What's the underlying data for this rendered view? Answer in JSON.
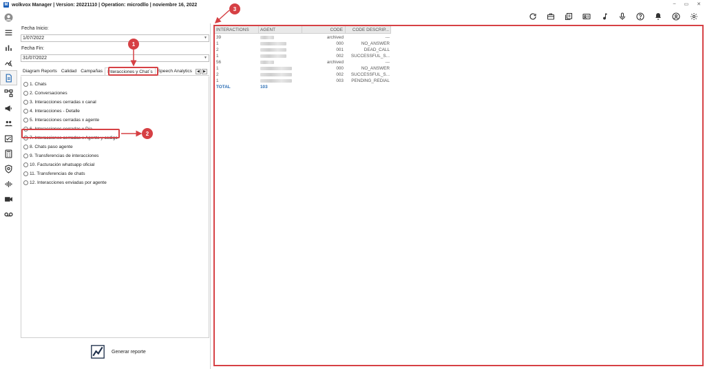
{
  "window": {
    "title": "wolkvox Manager  | Version: 20221110 |  Operation: microdllo | noviembre 16, 2022",
    "logo_letter": "M",
    "controls": [
      "–",
      "▭",
      "✕"
    ]
  },
  "toolbar": {
    "icons": [
      "refresh-icon",
      "briefcase-icon",
      "book-icon",
      "contact-card-icon",
      "music-note-icon",
      "microphone-icon",
      "help-icon",
      "bell-icon",
      "user-circle-icon",
      "gear-icon"
    ]
  },
  "rail": {
    "icons": [
      "user-avatar-icon",
      "menu-icon",
      "bar-chart-icon",
      "trend-icon",
      "reports-icon",
      "flow-icon",
      "megaphone-icon",
      "team-icon",
      "task-icon",
      "calculator-icon",
      "shield-icon",
      "audio-wave-icon",
      "video-icon",
      "voicemail-icon"
    ],
    "active_index": 4
  },
  "form": {
    "fecha_inicio_label": "Fecha Inicio:",
    "fecha_inicio_value": "1/07/2022",
    "fecha_fin_label": "Fecha Fin:",
    "fecha_fin_value": "31/07/2022"
  },
  "tabs": [
    {
      "label": "Diagram Reports",
      "selected": false
    },
    {
      "label": "Calidad",
      "selected": false
    },
    {
      "label": "Campañas",
      "selected": false
    },
    {
      "label": "Interacciones y Chat´s",
      "selected": true
    },
    {
      "label": "Speech Analytics",
      "selected": false
    }
  ],
  "reports": [
    {
      "label": "1. Chats",
      "checked": false
    },
    {
      "label": "2. Conversaciones",
      "checked": false
    },
    {
      "label": "3. Interacciones cerradas x canal",
      "checked": false
    },
    {
      "label": "4. Interacciones - Detalle",
      "checked": false
    },
    {
      "label": "5. Interacciones cerradas x agente",
      "checked": false
    },
    {
      "label": "6. Interacciones cerradas x Dia",
      "checked": false
    },
    {
      "label": "7. Interacciones cerradas x Agente y codigo",
      "checked": true
    },
    {
      "label": "8. Chats paso agente",
      "checked": false
    },
    {
      "label": "9. Transferencias de interacciones",
      "checked": false
    },
    {
      "label": "10. Facturación whatsapp oficial",
      "checked": false
    },
    {
      "label": "11. Transferencias de chats",
      "checked": false
    },
    {
      "label": "12. Interacciones enviadas por agente",
      "checked": false
    }
  ],
  "generate_button": {
    "label": "Generar reporte"
  },
  "grid": {
    "headers": [
      "INTERACTIONS",
      "AGENT",
      "CODE",
      "CODE DESCRIP..."
    ],
    "rows": [
      {
        "interactions": "39",
        "agent_redacted": true,
        "code": "archived",
        "desc": "---"
      },
      {
        "interactions": "1",
        "agent_redacted": true,
        "code": "000",
        "desc": "NO_ANSWER"
      },
      {
        "interactions": "2",
        "agent_redacted": true,
        "code": "001",
        "desc": "DEAD_CALL"
      },
      {
        "interactions": "1",
        "agent_redacted": true,
        "code": "002",
        "desc": "SUCCESSFUL_S..."
      },
      {
        "interactions": "56",
        "agent_redacted": true,
        "code": "archived",
        "desc": "---"
      },
      {
        "interactions": "1",
        "agent_redacted": true,
        "code": "000",
        "desc": "NO_ANSWER"
      },
      {
        "interactions": "2",
        "agent_redacted": true,
        "code": "002",
        "desc": "SUCCESSFUL_S..."
      },
      {
        "interactions": "1",
        "agent_redacted": true,
        "code": "003",
        "desc": "PENDING_REDIAL"
      }
    ],
    "total_label": "TOTAL",
    "total_value": "103"
  },
  "annotations": [
    "1",
    "2",
    "3"
  ],
  "colors": {
    "accent_red": "#d64044",
    "total_blue": "#2a6db4",
    "logo_blue": "#1b5fb8"
  }
}
